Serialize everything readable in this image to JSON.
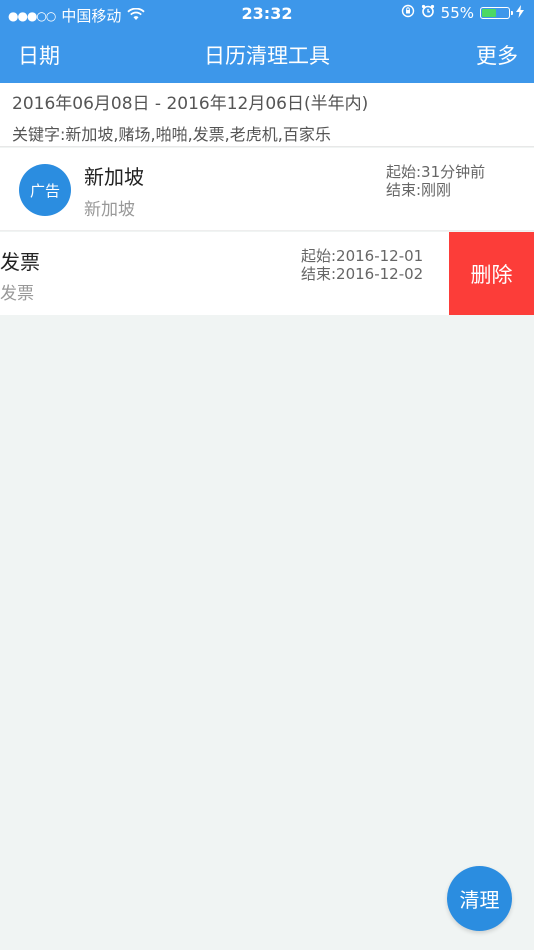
{
  "status_bar": {
    "signal": "●●●○○",
    "carrier": "中国移动",
    "time": "23:32",
    "battery_percent": "55%",
    "battery_level": 0.55
  },
  "nav": {
    "left": "日期",
    "title": "日历清理工具",
    "right": "更多"
  },
  "filter": {
    "date_range": "2016年06月08日 - 2016年12月06日(半年内)",
    "keywords": "关键字:新加坡,赌场,啪啪,发票,老虎机,百家乐"
  },
  "events": [
    {
      "badge": "广告",
      "title": "新加坡",
      "subtitle": "新加坡",
      "start": "起始:31分钟前",
      "end": "结束:刚刚"
    },
    {
      "title": "发票",
      "subtitle": "发票",
      "start": "起始:2016-12-01",
      "end": "结束:2016-12-02",
      "delete_label": "删除"
    }
  ],
  "fab": {
    "label": "清理"
  },
  "colors": {
    "accent": "#3d97ea",
    "badge": "#2b8de0",
    "delete": "#fc3d39",
    "battery_fill": "#4cd964",
    "background": "#f0f4f3"
  },
  "icons": [
    "wifi-icon",
    "lock-rotation-icon",
    "alarm-icon",
    "battery-icon",
    "charging-icon"
  ]
}
